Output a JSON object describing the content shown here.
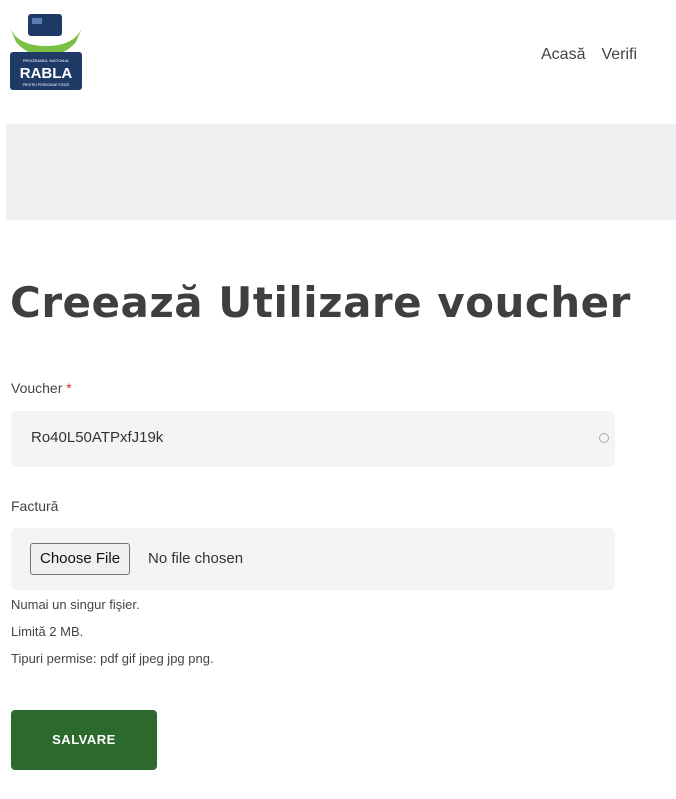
{
  "header": {
    "logo": {
      "top_text": "PROGRAMUL NATIONAL",
      "brand": "RABLA",
      "bottom_text": "PENTRU PERSOANE FIZICE"
    },
    "nav": [
      "Acasă",
      "Verifi"
    ]
  },
  "page": {
    "title": "Creează Utilizare voucher"
  },
  "form": {
    "voucher": {
      "label": "Voucher",
      "required_marker": "*",
      "value": "Ro40L50ATPxfJ19k"
    },
    "invoice": {
      "label": "Factură",
      "button_label": "Choose File",
      "status": "No file chosen",
      "help": [
        "Numai un singur fişier.",
        "Limită 2 MB.",
        "Tipuri permise: pdf gif jpeg jpg png."
      ]
    },
    "submit_label": "SALVARE"
  },
  "colors": {
    "primary_button": "#2b6a2c",
    "required": "#d62a2a",
    "banner": "#eeeff1"
  }
}
